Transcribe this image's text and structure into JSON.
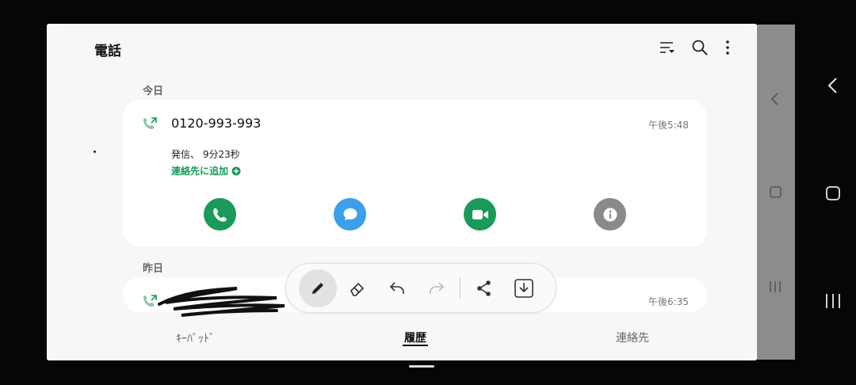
{
  "app": {
    "title": "電話"
  },
  "header": {
    "icons": [
      "filter-icon",
      "search-icon",
      "more-icon"
    ]
  },
  "sections": [
    {
      "label": "今日",
      "entry": {
        "number": "0120-993-993",
        "time": "午後5:48",
        "detail": "発信、 9分23秒",
        "add_contact": "連絡先に追加",
        "actions": [
          "call-icon",
          "message-icon",
          "video-call-icon",
          "info-icon"
        ]
      }
    },
    {
      "label": "昨日",
      "entry": {
        "time": "午後6:35"
      }
    }
  ],
  "tabs": [
    {
      "label": "ｷｰﾊﾟｯﾄﾞ",
      "active": false
    },
    {
      "label": "履歴",
      "active": true
    },
    {
      "label": "連絡先",
      "active": false
    }
  ],
  "toolbar": {
    "items": [
      "pen-icon",
      "eraser-icon",
      "undo-icon",
      "redo-icon",
      "share-icon",
      "save-icon"
    ]
  },
  "colors": {
    "accent_green": "#1a9a5a",
    "message_blue": "#3ca0e8",
    "info_gray": "#8a8a8a"
  }
}
